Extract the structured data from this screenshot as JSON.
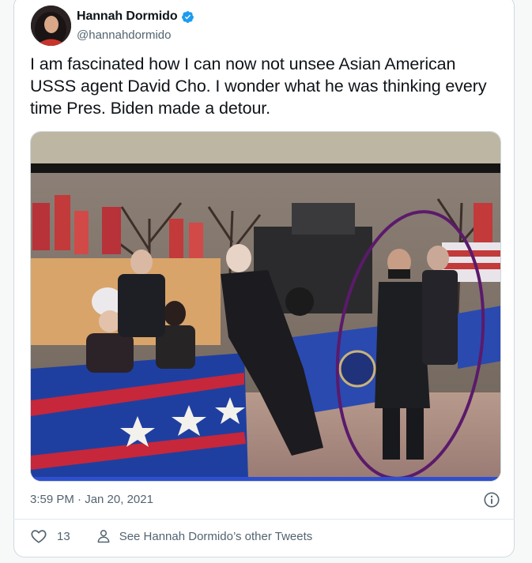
{
  "tweet": {
    "display_name": "Hannah Dormido",
    "handle": "@hannahdormido",
    "verified": true,
    "text": "I am fascinated how I can now not unsee Asian American USSS agent David Cho. I wonder what he was thinking every time Pres. Biden made a detour.",
    "timestamp": "3:59 PM · Jan 20, 2021",
    "like_count": "13",
    "see_other_label": "See Hannah Dormido’s other Tweets"
  },
  "icons": {
    "verified": "verified-badge-icon",
    "info": "info-icon",
    "like": "heart-icon",
    "profile": "person-icon"
  },
  "colors": {
    "verified": "#1d9bf0",
    "text_primary": "#0f1419",
    "text_secondary": "#536471",
    "border": "#cfd9de",
    "circle_annotation": "#5b1a6b"
  }
}
